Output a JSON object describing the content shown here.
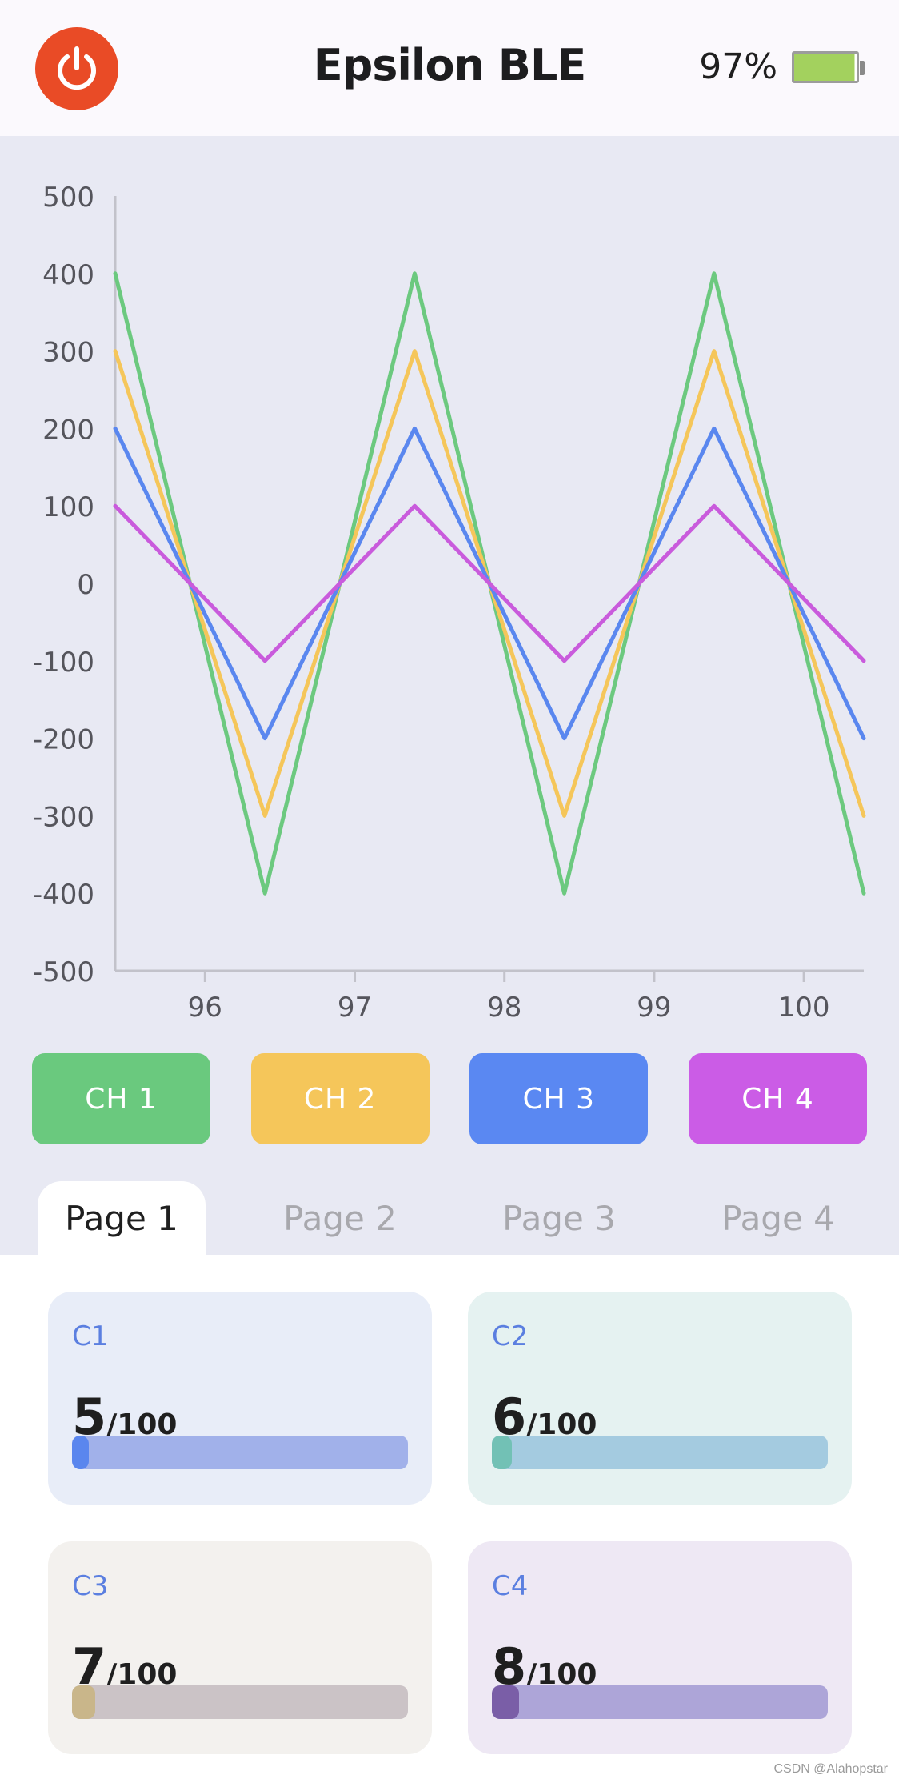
{
  "header": {
    "title": "Epsilon BLE",
    "battery_percent_label": "97%",
    "battery_level": 0.97,
    "power_icon": "power-icon"
  },
  "chart_data": {
    "type": "line",
    "xlim": [
      95.4,
      100.4
    ],
    "ylim": [
      -500,
      500
    ],
    "x_ticks": [
      "96",
      "97",
      "98",
      "99",
      "100"
    ],
    "y_ticks": [
      "500",
      "400",
      "300",
      "200",
      "100",
      "0",
      "-100",
      "-200",
      "-300",
      "-400",
      "-500"
    ],
    "x": [
      95.4,
      95.9,
      96.4,
      96.9,
      97.4,
      97.9,
      98.4,
      98.9,
      99.4,
      99.9,
      100.4
    ],
    "series": [
      {
        "color": "#6cc97f",
        "values": [
          400,
          0,
          -400,
          0,
          400,
          0,
          -400,
          0,
          400,
          0,
          -400
        ]
      },
      {
        "color": "#f5c65a",
        "values": [
          300,
          0,
          -300,
          0,
          300,
          0,
          -300,
          0,
          300,
          0,
          -300
        ]
      },
      {
        "color": "#5a87ef",
        "values": [
          200,
          0,
          -200,
          0,
          200,
          0,
          -200,
          0,
          200,
          0,
          -200
        ]
      },
      {
        "color": "#c95bdc",
        "values": [
          100,
          0,
          -100,
          0,
          100,
          0,
          -100,
          0,
          100,
          0,
          -100
        ]
      }
    ],
    "grid": false,
    "legend": "none"
  },
  "channels": [
    {
      "label": "CH 1",
      "color": "#6ac97e"
    },
    {
      "label": "CH 2",
      "color": "#f5c65a"
    },
    {
      "label": "CH 3",
      "color": "#5a88f2"
    },
    {
      "label": "CH 4",
      "color": "#cb5ce6"
    }
  ],
  "tabs": [
    {
      "label": "Page 1",
      "active": true
    },
    {
      "label": "Page 2",
      "active": false
    },
    {
      "label": "Page 3",
      "active": false
    },
    {
      "label": "Page 4",
      "active": false
    }
  ],
  "cards": [
    {
      "label": "C1",
      "value": "5",
      "max": "/100",
      "fraction": 0.05,
      "bg": "#e8edf8",
      "track": "#a1b1ea",
      "fill": "#5a86ee"
    },
    {
      "label": "C2",
      "value": "6",
      "max": "/100",
      "fraction": 0.06,
      "bg": "#e5f2f1",
      "track": "#a4cbe0",
      "fill": "#72c1b5"
    },
    {
      "label": "C3",
      "value": "7",
      "max": "/100",
      "fraction": 0.07,
      "bg": "#f3f1ee",
      "track": "#cbc3c6",
      "fill": "#c9b68a"
    },
    {
      "label": "C4",
      "value": "8",
      "max": "/100",
      "fraction": 0.08,
      "bg": "#eee8f4",
      "track": "#ada5d8",
      "fill": "#7a5ea7"
    }
  ],
  "watermark": "CSDN @Alahopstar"
}
